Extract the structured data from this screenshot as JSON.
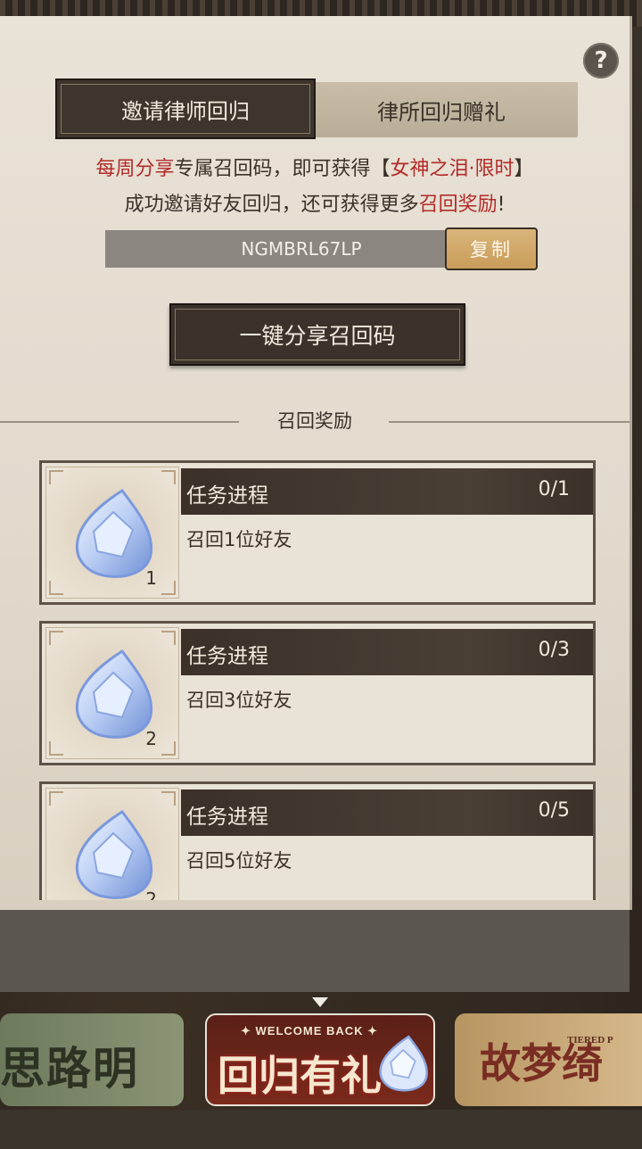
{
  "help": {
    "label": "?"
  },
  "tabs": {
    "active": "邀请律师回归",
    "inactive": "律所回归赠礼"
  },
  "intro": {
    "line1_red1": "每周分享",
    "line1_mid": "专属召回码，即可获得【",
    "line1_red2": "女神之泪·限时",
    "line1_end": "】",
    "line2_start": "成功邀请好友回归，还可获得更多",
    "line2_red": "召回奖励",
    "line2_end": "!"
  },
  "code": {
    "value": "NGMBRL67LP",
    "copy_label": "复制"
  },
  "share_button": "一键分享召回码",
  "section_title": "召回奖励",
  "tasks": [
    {
      "header": "任务进程",
      "progress": "0/1",
      "desc": "召回1位好友",
      "qty": "1"
    },
    {
      "header": "任务进程",
      "progress": "0/3",
      "desc": "召回3位好友",
      "qty": "2"
    },
    {
      "header": "任务进程",
      "progress": "0/5",
      "desc": "召回5位好友",
      "qty": "2"
    }
  ],
  "banners": {
    "left": "思路明轨",
    "mid_small": "✦ WELCOME BACK ✦",
    "mid": "回归有礼",
    "right_small": "TIERED P",
    "right": "故梦绮"
  },
  "icons": [
    "help-icon",
    "tear-gem-icon"
  ],
  "colors": {
    "accent_red": "#b32b2b",
    "dark_brown": "#3e352d",
    "gold": "#d9b47a"
  }
}
